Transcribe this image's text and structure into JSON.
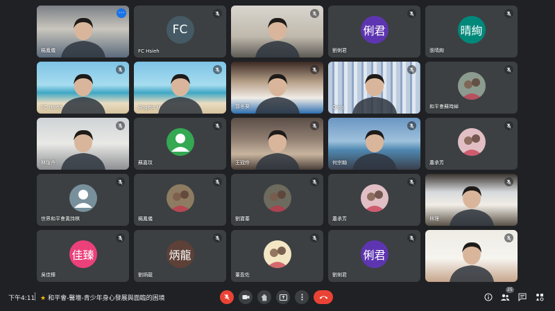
{
  "meeting": {
    "time": "下午4:11",
    "title": "和平會-醫壇-青少年身心發展與面臨的困境",
    "participant_count": "25"
  },
  "colors": {
    "background": "#202124",
    "tile": "#3c4043",
    "accent_blue": "#8ab4f8",
    "danger": "#ea4335"
  },
  "tiles": [
    {
      "name": "楊鳳儀",
      "kind": "video",
      "scene": "office",
      "active": true
    },
    {
      "name": "FC Hsieh",
      "kind": "initials",
      "initials": "FC",
      "color": "#455a64"
    },
    {
      "name": "",
      "kind": "video",
      "scene": "room-white"
    },
    {
      "name": "劉俐君",
      "kind": "initials",
      "initials": "俐君",
      "color": "#5e35b1"
    },
    {
      "name": "張晴絢",
      "kind": "initials",
      "initials": "晴絢",
      "color": "#00897b"
    },
    {
      "name": "FC Hsieh",
      "kind": "video",
      "scene": "beach"
    },
    {
      "name": "Angela H",
      "kind": "video",
      "scene": "beach"
    },
    {
      "name": "郭冬葵",
      "kind": "video",
      "scene": "shelves"
    },
    {
      "name": "Qing",
      "kind": "video",
      "scene": "curtain"
    },
    {
      "name": "和平會蘇時綽",
      "kind": "photo",
      "color": "#8c9b8f"
    },
    {
      "name": "林瑄卉",
      "kind": "video",
      "scene": "office-light"
    },
    {
      "name": "蘇嘉玟",
      "kind": "default",
      "color": "#34a853"
    },
    {
      "name": "王冠伶",
      "kind": "video",
      "scene": "ceiling"
    },
    {
      "name": "何宗翰",
      "kind": "video",
      "scene": "sea"
    },
    {
      "name": "蕭承芳",
      "kind": "photo",
      "color": "#e1bfc4"
    },
    {
      "name": "世界和平會黃詩棋",
      "kind": "default",
      "color": "#78909c"
    },
    {
      "name": "楊鳳儀",
      "kind": "photo",
      "color": "#8d7b62"
    },
    {
      "name": "劉寶蓁",
      "kind": "photo",
      "color": "#6d6a5e"
    },
    {
      "name": "蕭承芳",
      "kind": "photo",
      "color": "#e1bfc4"
    },
    {
      "name": "林理",
      "kind": "video",
      "scene": "window"
    },
    {
      "name": "吳佳臻",
      "kind": "initials",
      "initials": "佳臻",
      "color": "#ec407a"
    },
    {
      "name": "劉炳龍",
      "kind": "initials",
      "initials": "炳龍",
      "color": "#5d4037"
    },
    {
      "name": "董盈佐",
      "kind": "photo",
      "color": "#f3e6c4"
    },
    {
      "name": "劉俐君",
      "kind": "initials",
      "initials": "俐君",
      "color": "#5e35b1"
    },
    {
      "name": "",
      "kind": "video",
      "scene": "bright-room"
    }
  ],
  "icons": {
    "mic": "mic-off-icon",
    "camera": "camera-icon",
    "hand": "raise-hand-icon",
    "present": "present-screen-icon",
    "more": "more-options-icon",
    "hangup": "hang-up-icon",
    "info": "info-icon",
    "people": "people-icon",
    "chat": "chat-icon",
    "activities": "activities-icon"
  }
}
